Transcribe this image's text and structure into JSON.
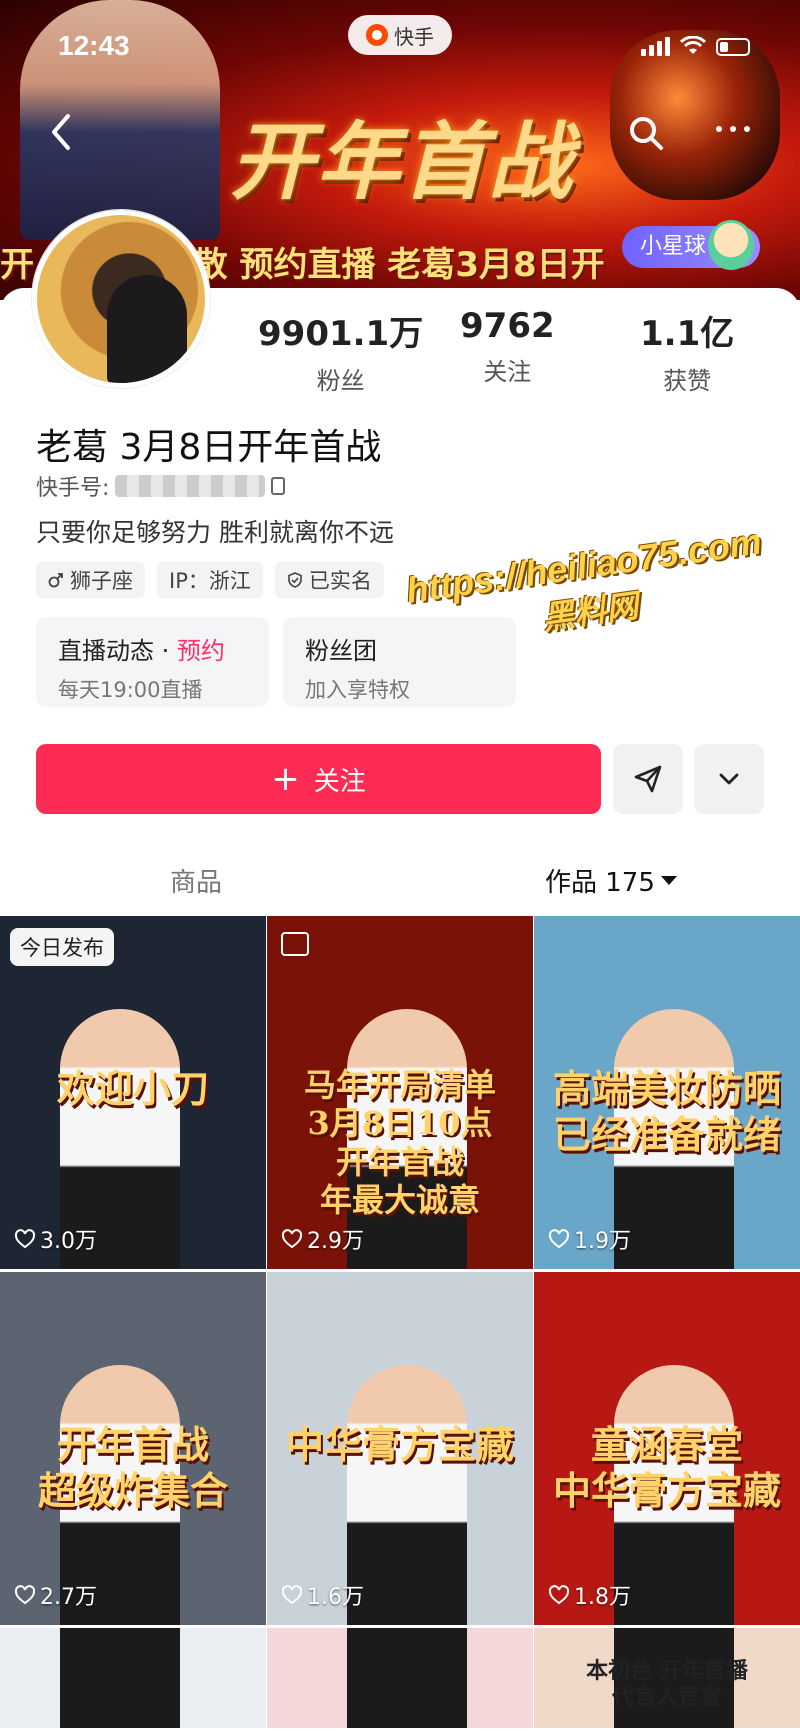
{
  "status_bar": {
    "time": "12:43"
  },
  "app": {
    "name": "快手"
  },
  "banner": {
    "title": "开年首战",
    "marquee": "开 京 不见不散   预约直播   老葛3月8日开"
  },
  "star_badge": {
    "label": "小星球"
  },
  "profile": {
    "name": "老葛 3月8日开年首战",
    "kuaishou_id_label": "快手号:",
    "bio": "只要你足够努力 胜利就离你不远",
    "stats": [
      {
        "value": "9901.1万",
        "label": "粉丝"
      },
      {
        "value": "9762",
        "label": "关注"
      },
      {
        "value": "1.1亿",
        "label": "获赞"
      }
    ],
    "tags": [
      {
        "icon": "male-icon",
        "label": "狮子座"
      },
      {
        "icon": "",
        "label": "IP：浙江"
      },
      {
        "icon": "verified-shield-icon",
        "label": "已实名"
      }
    ]
  },
  "info_boxes": [
    {
      "title": "直播动态",
      "accent": "预约",
      "sub": "每天19:00直播"
    },
    {
      "title": "粉丝团",
      "accent": "",
      "sub": "加入享特权"
    }
  ],
  "actions": {
    "follow_label": "关注"
  },
  "tabs": {
    "goods": "商品",
    "works": "作品 175"
  },
  "watermark": {
    "url": "https://heiliao75.com",
    "name": "黑料网"
  },
  "videos": [
    {
      "badge": "今日发布",
      "caption": "欢迎小刀",
      "likes": "3.0万",
      "bg": "#1f2633"
    },
    {
      "badge": "",
      "caption": "马年开局清单\n3月8日10点\n开年首战\n年最大诚意",
      "likes": "2.9万",
      "bg": "#7a1208"
    },
    {
      "badge": "",
      "caption": "高端美妆防晒\n已经准备就绪",
      "likes": "1.9万",
      "bg": "#6aa6c8"
    },
    {
      "badge": "",
      "caption": "开年首战\n超级炸集合",
      "likes": "2.7万",
      "bg": "#5b6470"
    },
    {
      "badge": "",
      "caption": "中华膏方宝藏",
      "likes": "1.6万",
      "bg": "#c9d2d8"
    },
    {
      "badge": "",
      "caption": "童涵春堂\n中华膏方宝藏",
      "likes": "1.8万",
      "bg": "#b71814"
    },
    {
      "badge": "",
      "caption": "",
      "likes": "",
      "bg": "#e9eef3"
    },
    {
      "badge": "",
      "caption": "",
      "likes": "",
      "bg": "#f4d7d9"
    },
    {
      "badge": "",
      "caption": "本初色 开年首播\n代言人官宣",
      "likes": "",
      "bg": "#f0d9c9"
    }
  ],
  "colors": {
    "accent": "#fe2c55",
    "pink_text": "#ff2f6a"
  }
}
